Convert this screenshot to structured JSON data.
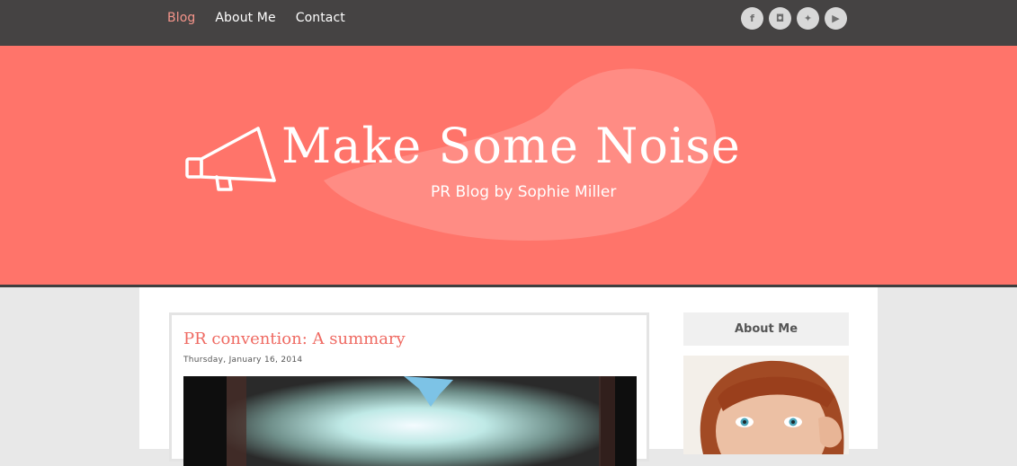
{
  "nav": {
    "items": [
      {
        "label": "Blog",
        "active": true
      },
      {
        "label": "About Me",
        "active": false
      },
      {
        "label": "Contact",
        "active": false
      }
    ]
  },
  "social": {
    "icons": [
      {
        "name": "facebook-icon",
        "glyph": "f"
      },
      {
        "name": "instagram-icon",
        "glyph": "◘"
      },
      {
        "name": "twitter-icon",
        "glyph": "✦"
      },
      {
        "name": "youtube-icon",
        "glyph": "▶"
      }
    ]
  },
  "hero": {
    "title": "Make Some Noise",
    "tagline": "PR Blog by Sophie Miller",
    "colors": {
      "background": "#ff746a",
      "blob": "#ff8c84",
      "text": "#ffffff"
    }
  },
  "post": {
    "title": "PR convention: A summary",
    "date": "Thursday, January 16, 2014"
  },
  "sidebar": {
    "heading": "About Me"
  },
  "colors": {
    "topbar": "#454343",
    "nav_active": "#f4948a",
    "accent": "#ef6a62"
  }
}
